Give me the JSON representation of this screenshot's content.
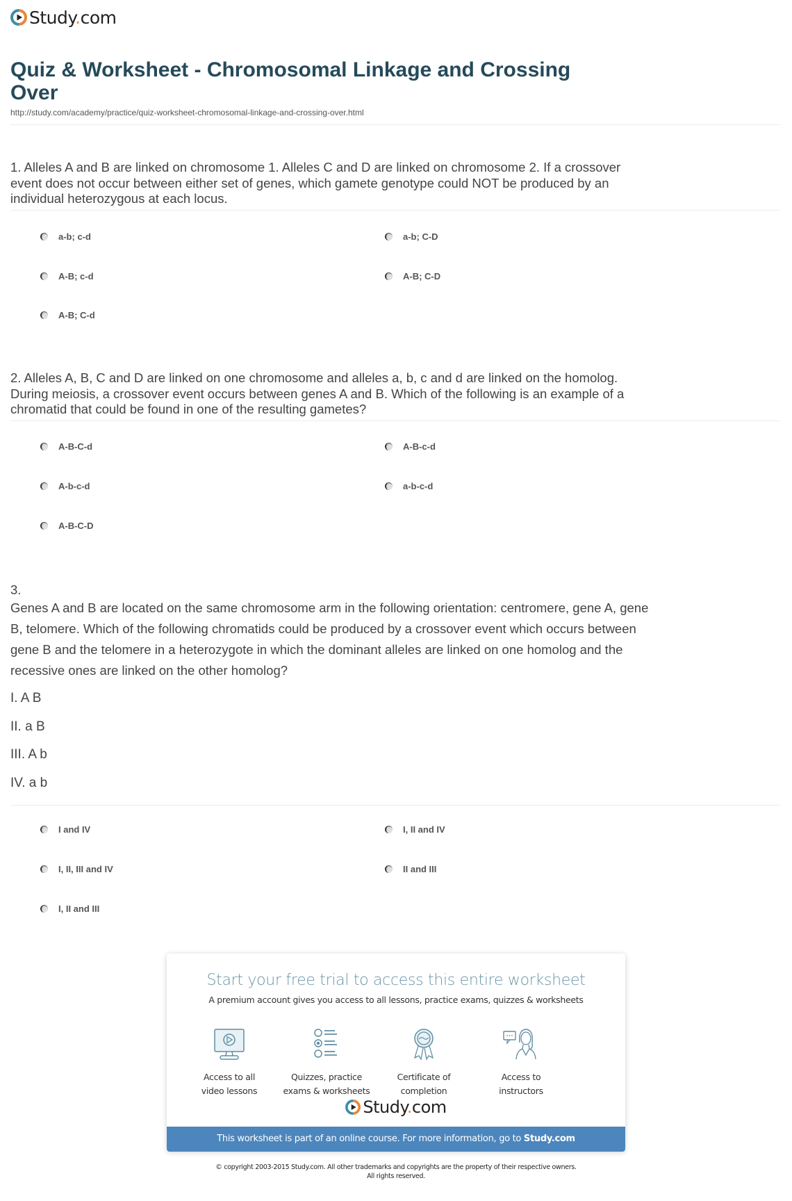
{
  "brand": {
    "name_main": "Study",
    "name_dot": ".",
    "name_tld": "com",
    "colors": {
      "teal": "#3b8ea5",
      "orange": "#e8873a",
      "title": "#254a5a",
      "bar": "#4c86bd"
    }
  },
  "header": {
    "title": "Quiz & Worksheet - Chromosomal Linkage and Crossing Over",
    "url": "http://study.com/academy/practice/quiz-worksheet-chromosomal-linkage-and-crossing-over.html"
  },
  "questions": [
    {
      "text": "1. Alleles A and B are linked on chromosome 1. Alleles C and D are linked on chromosome 2. If a crossover event does not occur between either set of genes, which gamete genotype could NOT be produced by an individual heterozygous at each locus.",
      "options": [
        "a-b; c-d",
        "a-b; C-D",
        "A-B; c-d",
        "A-B; C-D",
        "A-B; C-d"
      ]
    },
    {
      "text": "2. Alleles A, B, C and D are linked on one chromosome and alleles a, b, c and d are linked on the homolog. During meiosis, a crossover event occurs between genes A and B. Which of the following is an example of a chromatid that could be found in one of the resulting gametes?",
      "options": [
        "A-B-C-d",
        "A-B-c-d",
        "A-b-c-d",
        "a-b-c-d",
        "A-B-C-D"
      ]
    },
    {
      "number": "3.",
      "text": "Genes A and B are located on the same chromosome arm in the following orientation: centromere, gene A, gene B, telomere. Which of the following chromatids could be produced by a crossover event which occurs between gene B and the telomere in a heterozygote in which the dominant alleles are linked on one homolog and the recessive ones are linked on the other homolog?",
      "statements": [
        "I. A B",
        "II. a B",
        "III. A b",
        "IV. a b"
      ],
      "options": [
        "I and IV",
        "I, II and IV",
        "I, II, III and IV",
        "II and III",
        "I, II and III"
      ]
    }
  ],
  "promo": {
    "title": "Start your free trial to access this entire worksheet",
    "subtitle": "A premium account gives you access to all lessons, practice exams, quizzes & worksheets",
    "features": [
      {
        "icon": "video-monitor-icon",
        "line1": "Access to all",
        "line2": "video lessons"
      },
      {
        "icon": "checklist-icon",
        "line1": "Quizzes, practice",
        "line2": "exams & worksheets"
      },
      {
        "icon": "certificate-ribbon-icon",
        "line1": "Certificate of",
        "line2": "completion"
      },
      {
        "icon": "instructor-chat-icon",
        "line1": "Access to",
        "line2": "instructors"
      }
    ],
    "bar_text": "This worksheet is part of an online course. For more information, go to ",
    "bar_link": "Study.com"
  },
  "footer": {
    "copyright_line1": "© copyright 2003-2015 Study.com. All other trademarks and copyrights are the property of their respective owners.",
    "copyright_line2": "All rights reserved."
  }
}
